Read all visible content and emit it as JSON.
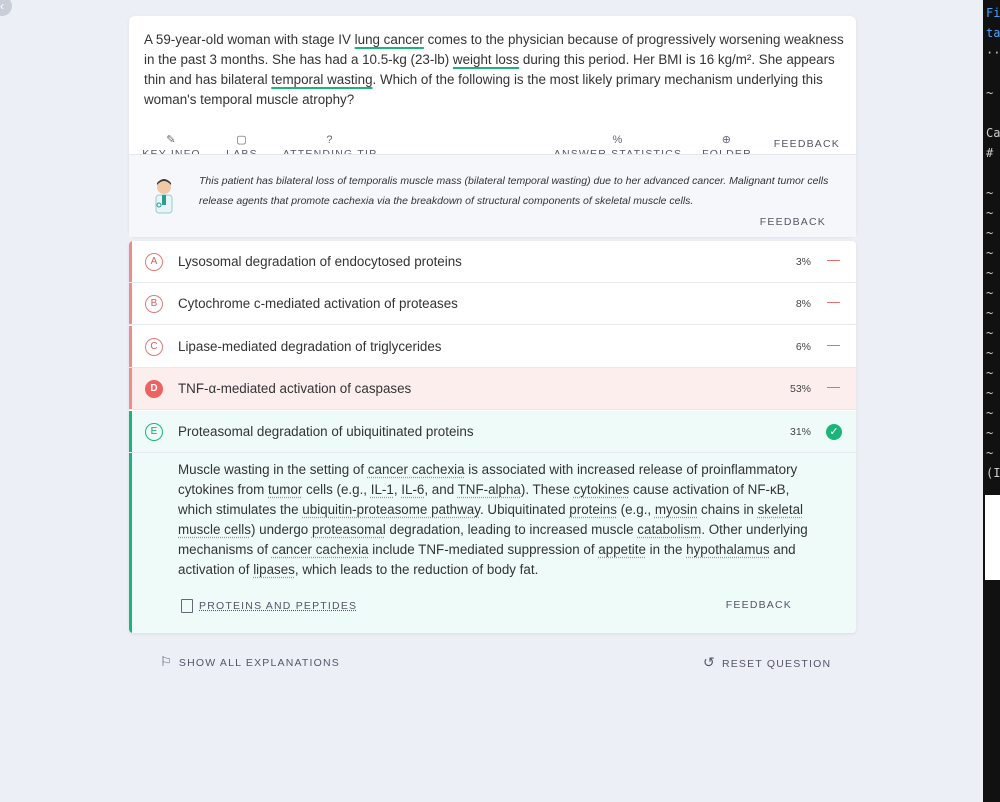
{
  "nav": {
    "back_icon": "chevron-left-icon"
  },
  "question": {
    "segments": [
      {
        "text": "A 59-year-old woman with stage IV ",
        "u": false
      },
      {
        "text": "lung cancer",
        "u": true
      },
      {
        "text": " comes to the physician because of progressively worsening weakness in the past 3 months. She has had a 10.5-kg (23-lb) ",
        "u": false
      },
      {
        "text": "weight loss",
        "u": true
      },
      {
        "text": " during this period. Her BMI is 16 kg/m². She appears thin and has bilateral ",
        "u": false
      },
      {
        "text": "temporal wasting",
        "u": true
      },
      {
        "text": ". Which of the following is the most likely primary mechanism underlying this woman's temporal muscle atrophy?",
        "u": false
      }
    ]
  },
  "tabs": {
    "key_info": "KEY INFO",
    "labs": "LABS",
    "attending_tip": "ATTENDING TIP",
    "answer_statistics": "ANSWER STATISTICS",
    "folder": "FOLDER",
    "feedback": "FEEDBACK"
  },
  "tip": {
    "text": "This patient has bilateral loss of temporalis muscle mass (bilateral temporal wasting) due to her advanced cancer. Malignant tumor cells release agents that promote cachexia via the breakdown of structural components of skeletal muscle cells.",
    "feedback": "FEEDBACK"
  },
  "answers": [
    {
      "letter": "A",
      "text": "Lysosomal degradation of endocytosed proteins",
      "pct": "3%",
      "state": "normal"
    },
    {
      "letter": "B",
      "text": "Cytochrome c-mediated activation of proteases",
      "pct": "8%",
      "state": "normal"
    },
    {
      "letter": "C",
      "text": "Lipase-mediated degradation of triglycerides",
      "pct": "6%",
      "state": "normal"
    },
    {
      "letter": "D",
      "text": "TNF-α-mediated activation of caspases",
      "pct": "53%",
      "state": "selected"
    },
    {
      "letter": "E",
      "text": "Proteasomal degradation of ubiquitinated proteins",
      "pct": "31%",
      "state": "correct"
    }
  ],
  "explanation": {
    "segments": [
      {
        "text": "Muscle wasting in the setting of ",
        "u": false
      },
      {
        "text": "cancer cachexia",
        "u": true
      },
      {
        "text": " is associated with increased release of proinflammatory cytokines from ",
        "u": false
      },
      {
        "text": "tumor",
        "u": true
      },
      {
        "text": " cells (e.g., ",
        "u": false
      },
      {
        "text": "IL-1",
        "u": true
      },
      {
        "text": ", ",
        "u": false
      },
      {
        "text": "IL-6",
        "u": true
      },
      {
        "text": ", and ",
        "u": false
      },
      {
        "text": "TNF-alpha",
        "u": true
      },
      {
        "text": "). These ",
        "u": false
      },
      {
        "text": "cytokines",
        "u": true
      },
      {
        "text": " cause activation of NF-κB, which stimulates the ",
        "u": false
      },
      {
        "text": "ubiquitin-proteasome pathway",
        "u": true
      },
      {
        "text": ". Ubiquitinated ",
        "u": false
      },
      {
        "text": "proteins",
        "u": true
      },
      {
        "text": " (e.g., ",
        "u": false
      },
      {
        "text": "myosin",
        "u": true
      },
      {
        "text": " chains in ",
        "u": false
      },
      {
        "text": "skeletal muscle cells",
        "u": true
      },
      {
        "text": ") undergo ",
        "u": false
      },
      {
        "text": "proteasomal",
        "u": true
      },
      {
        "text": " degradation, leading to increased muscle ",
        "u": false
      },
      {
        "text": "catabolism",
        "u": true
      },
      {
        "text": ". Other underlying mechanisms of ",
        "u": false
      },
      {
        "text": "cancer cachexia",
        "u": true
      },
      {
        "text": " include TNF-mediated suppression of ",
        "u": false
      },
      {
        "text": "appetite",
        "u": true
      },
      {
        "text": " in the ",
        "u": false
      },
      {
        "text": "hypothalamus",
        "u": true
      },
      {
        "text": " and activation of ",
        "u": false
      },
      {
        "text": "lipases",
        "u": true
      },
      {
        "text": ", which leads to the reduction of body fat.",
        "u": false
      }
    ],
    "topic": "PROTEINS AND PEPTIDES",
    "feedback": "FEEDBACK"
  },
  "footer": {
    "show_all": "SHOW ALL EXPLANATIONS",
    "reset": "RESET QUESTION"
  },
  "side_panel": {
    "lines": [
      "Fi",
      "ta",
      "··",
      "",
      "~",
      "",
      "Ca",
      "#",
      "",
      "~",
      "~",
      "~",
      "~",
      "~",
      "~",
      "~",
      "~",
      "~",
      "~",
      "~",
      "~",
      "~",
      "~",
      "(I"
    ]
  },
  "colors": {
    "accent_green": "#1bb57a",
    "wrong_red": "#ef6262",
    "selected_bg": "#fdeeee",
    "correct_bg": "#effbf8"
  }
}
